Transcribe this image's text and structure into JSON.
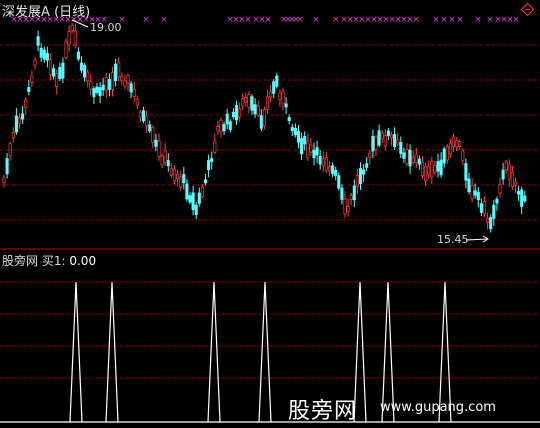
{
  "header": {
    "stock_name": "深发展",
    "flag": "A",
    "period": "(日线)"
  },
  "price_panel": {
    "high_label": "19.00",
    "low_label": "15.45",
    "signal_x_marks": [
      14,
      20,
      26,
      32,
      38,
      44,
      50,
      56,
      62,
      68,
      74,
      80,
      86,
      92,
      98,
      104,
      122,
      146,
      164,
      230,
      236,
      242,
      248,
      256,
      262,
      268,
      284,
      288,
      292,
      296,
      300,
      316,
      336,
      344,
      350,
      356,
      362,
      368,
      374,
      380,
      386,
      392,
      398,
      404,
      410,
      416,
      436,
      444,
      452,
      460,
      478,
      490,
      498,
      504,
      510,
      516
    ]
  },
  "indicator_panel": {
    "name": "股旁网",
    "label": "买1:",
    "value": "0.00",
    "spike_x": [
      76,
      112,
      214,
      265,
      360,
      388,
      445
    ]
  },
  "watermark": {
    "text": "股旁网",
    "site": "www.gupang.com"
  },
  "colors": {
    "up": "#ff3b3b",
    "down": "#54ffff",
    "signal": "#e040e0",
    "grid": "#8b0000",
    "line": "#ffffff"
  }
}
